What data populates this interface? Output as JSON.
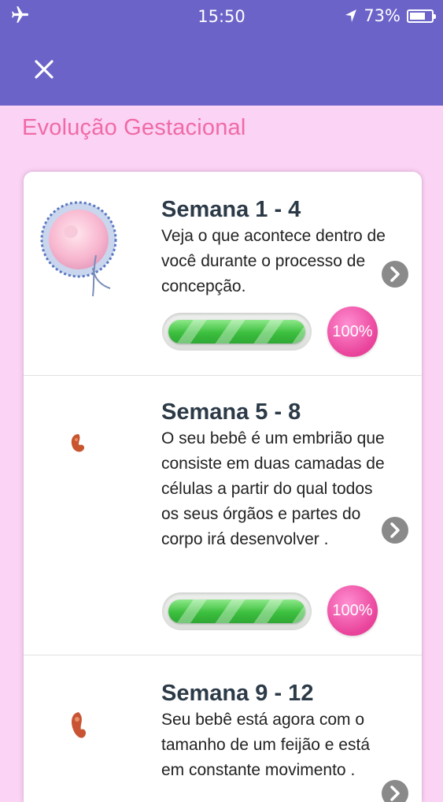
{
  "status_bar": {
    "time": "15:50",
    "battery": "73%",
    "battery_level": 0.73
  },
  "header": {
    "close_icon": "close-icon"
  },
  "page": {
    "title": "Evolução Gestacional"
  },
  "weeks": [
    {
      "title": "Semana 1 - 4",
      "description": "Veja o que acontece dentro de você durante o processo de concepção.",
      "progress_label": "100%",
      "progress": 1.0
    },
    {
      "title": "Semana 5 - 8",
      "description": "O seu bebê é um embrião que consiste em duas camadas de células a partir do qual todos os seus órgãos e partes do corpo irá desenvolver .",
      "progress_label": "100%",
      "progress": 1.0
    },
    {
      "title": "Semana 9 - 12",
      "description": "Seu bebê está agora com o tamanho de um feijão e está em constante movimento ."
    }
  ],
  "colors": {
    "header": "#6b63c8",
    "background": "#fbd3f4",
    "title": "#f06aa6",
    "progress": "#3cbf3e",
    "badge": "#e9429a"
  }
}
